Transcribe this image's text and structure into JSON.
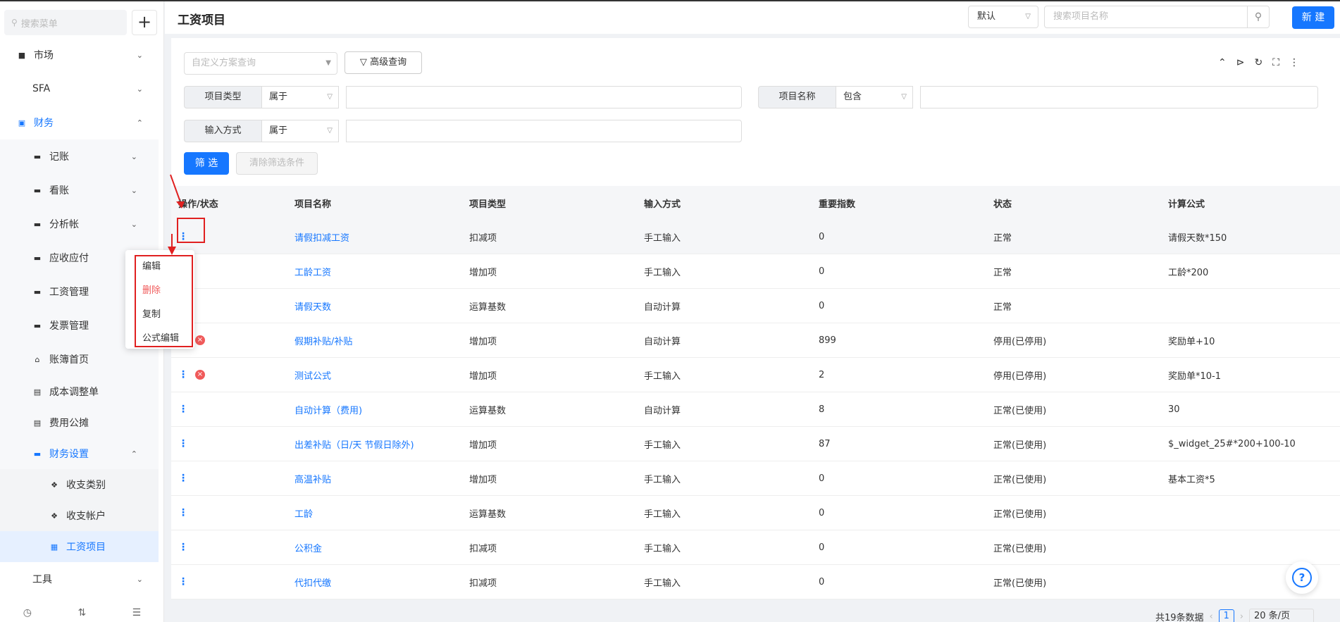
{
  "sidebar": {
    "search_placeholder": "搜索菜单",
    "add_label": "+",
    "items": [
      {
        "label": "市场",
        "icon": "bookmark-icon",
        "chev": "⌄"
      },
      {
        "label": "SFA",
        "chev": "⌄"
      },
      {
        "label": "财务",
        "icon": "lock-icon",
        "chev": "⌃"
      },
      {
        "label": "记账",
        "icon": "folder-icon",
        "chev": "⌄"
      },
      {
        "label": "看账",
        "icon": "folder-icon",
        "chev": "⌄"
      },
      {
        "label": "分析帐",
        "icon": "folder-icon",
        "chev": "⌄"
      },
      {
        "label": "应收应付",
        "icon": "folder-icon"
      },
      {
        "label": "工资管理",
        "icon": "folder-icon"
      },
      {
        "label": "发票管理",
        "icon": "folder-icon"
      },
      {
        "label": "账簿首页",
        "icon": "home-icon"
      },
      {
        "label": "成本调整单",
        "icon": "document-icon"
      },
      {
        "label": "费用公摊",
        "icon": "document-icon"
      },
      {
        "label": "财务设置",
        "icon": "folder-icon",
        "chev": "⌃"
      },
      {
        "label": "收支类别",
        "icon": "diamond-icon"
      },
      {
        "label": "收支帐户",
        "icon": "diamond-icon"
      },
      {
        "label": "工资项目",
        "icon": "card-icon"
      },
      {
        "label": "工具",
        "chev": "⌄"
      }
    ],
    "bottom_icons": [
      "history-icon",
      "sort-icon",
      "collapse-menu-icon"
    ]
  },
  "header": {
    "title": "工资项目",
    "view_select": "默认",
    "search_placeholder": "搜索项目名称",
    "new_label": "新 建"
  },
  "filters": {
    "scheme_placeholder": "自定义方案查询",
    "advanced_label": "高级查询",
    "rows": [
      {
        "label": "项目类型",
        "op": "属于"
      },
      {
        "label": "项目名称",
        "op": "包含"
      },
      {
        "label": "输入方式",
        "op": "属于"
      }
    ],
    "filter_label": "筛 选",
    "clear_label": "清除筛选条件"
  },
  "table": {
    "headers": [
      "操作/状态",
      "项目名称",
      "项目类型",
      "输入方式",
      "重要指数",
      "状态",
      "计算公式"
    ],
    "rows": [
      {
        "name": "请假扣减工资",
        "type": "扣减项",
        "input": "手工输入",
        "index": "0",
        "status": "正常",
        "formula": "请假天数*150",
        "disabled": false
      },
      {
        "name": "工龄工资",
        "type": "增加项",
        "input": "手工输入",
        "index": "0",
        "status": "正常",
        "formula": "工龄*200",
        "disabled": false
      },
      {
        "name": "请假天数",
        "type": "运算基数",
        "input": "自动计算",
        "index": "0",
        "status": "正常",
        "formula": "",
        "disabled": false
      },
      {
        "name": "假期补贴/补贴",
        "type": "增加项",
        "input": "自动计算",
        "index": "899",
        "status": "停用(已停用)",
        "formula": "奖励单+10",
        "disabled": true
      },
      {
        "name": "测试公式",
        "type": "增加项",
        "input": "手工输入",
        "index": "2",
        "status": "停用(已停用)",
        "formula": "奖励单*10-1",
        "disabled": true
      },
      {
        "name": "自动计算（费用)",
        "type": "运算基数",
        "input": "自动计算",
        "index": "8",
        "status": "正常(已使用)",
        "formula": "30",
        "disabled": false
      },
      {
        "name": "出差补贴（日/天 节假日除外)",
        "type": "增加项",
        "input": "手工输入",
        "index": "87",
        "status": "正常(已使用)",
        "formula": "$_widget_25#*200+100-10",
        "disabled": false
      },
      {
        "name": "高温补贴",
        "type": "增加项",
        "input": "手工输入",
        "index": "0",
        "status": "正常(已使用)",
        "formula": "基本工资*5",
        "disabled": false
      },
      {
        "name": "工龄",
        "type": "运算基数",
        "input": "手工输入",
        "index": "0",
        "status": "正常(已使用)",
        "formula": "",
        "disabled": false
      },
      {
        "name": "公积金",
        "type": "扣减项",
        "input": "手工输入",
        "index": "0",
        "status": "正常(已使用)",
        "formula": "",
        "disabled": false
      },
      {
        "name": "代扣代缴",
        "type": "扣减项",
        "input": "手工输入",
        "index": "0",
        "status": "正常(已使用)",
        "formula": "",
        "disabled": false
      }
    ]
  },
  "popup_menu": {
    "items": [
      {
        "label": "编辑",
        "danger": false
      },
      {
        "label": "删除",
        "danger": true
      },
      {
        "label": "复制",
        "danger": false
      },
      {
        "label": "公式编辑",
        "danger": false
      }
    ]
  },
  "pagination": {
    "total": "共19条数据",
    "current": "1",
    "page_size": "20 条/页"
  },
  "colors": {
    "accent": "#1677ff",
    "danger": "#f05a5a",
    "annotation": "#e02020"
  }
}
